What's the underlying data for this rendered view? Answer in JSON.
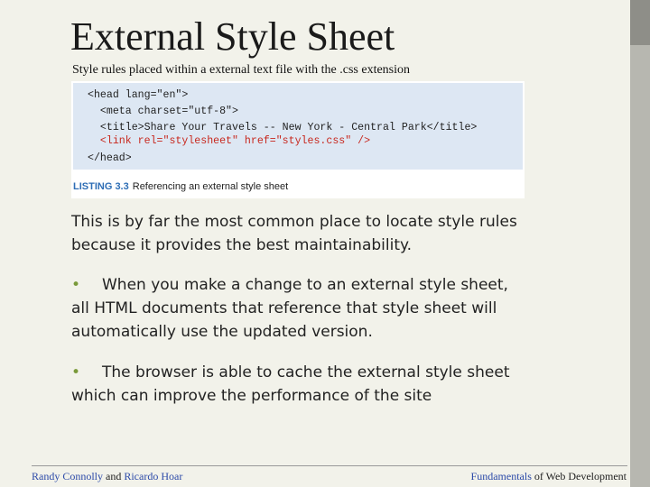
{
  "slide": {
    "title": "External Style Sheet",
    "subtitle": "Style rules placed within a external text file with the .css extension"
  },
  "listing": {
    "code_lines": [
      "<head lang=\"en\">",
      "  <meta charset=\"utf-8\">",
      "  <title>Share Your Travels -- New York - Central Park</title>",
      "  <link rel=\"stylesheet\" href=\"styles.css\" />",
      "</head>"
    ],
    "caption_label": "LISTING 3.3",
    "caption_text": "Referencing an external style sheet",
    "highlight_color": "#c8281e"
  },
  "content": {
    "intro": "This is by far the most common place to locate style rules because it provides the best maintainability.",
    "bullet_symbol": "•",
    "bullets": [
      "When you make a change to an external style sheet, all HTML documents that reference that style sheet will automatically use the updated version.",
      "The browser is able to cache the external style sheet which can improve the performance of the site"
    ]
  },
  "footer": {
    "author_1": "Randy Connolly",
    "author_joiner": " and ",
    "author_2": "Ricardo Hoar",
    "book_part_1": "Fundamentals",
    "book_joiner": " of ",
    "book_part_2": "Web Development"
  },
  "colors": {
    "background": "#f2f2ea",
    "side_bar": "#b7b7b0",
    "code_background": "#dde7f3",
    "listing_label": "#2d6db5",
    "bullet": "#7a9a3a",
    "footer_link": "#2b49a8"
  }
}
